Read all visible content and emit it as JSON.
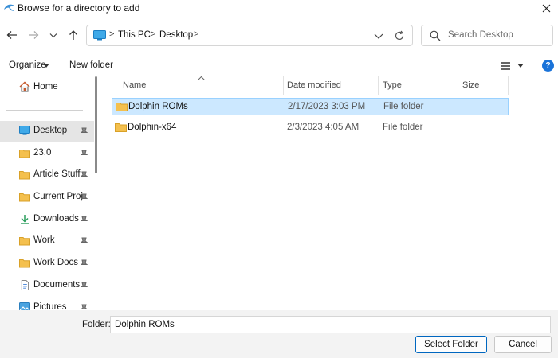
{
  "window": {
    "title": "Browse for a directory to add"
  },
  "address": {
    "crumbs": [
      "This PC",
      "Desktop"
    ],
    "separator": ">"
  },
  "search": {
    "placeholder": "Search Desktop"
  },
  "toolbar": {
    "organize_label": "Organize",
    "new_folder_label": "New folder",
    "help_label": "?"
  },
  "sidebar": {
    "home_label": "Home",
    "items": [
      {
        "label": "Desktop",
        "icon": "desktop-icon",
        "pinned": true,
        "selected": true
      },
      {
        "label": "23.0",
        "icon": "folder-icon",
        "pinned": true
      },
      {
        "label": "Article Stuff",
        "icon": "folder-icon",
        "pinned": true
      },
      {
        "label": "Current Proje",
        "icon": "folder-icon",
        "pinned": true
      },
      {
        "label": "Downloads",
        "icon": "download-icon",
        "pinned": true
      },
      {
        "label": "Work",
        "icon": "folder-icon",
        "pinned": true
      },
      {
        "label": "Work Docs",
        "icon": "folder-icon",
        "pinned": true
      },
      {
        "label": "Documents",
        "icon": "documents-icon",
        "pinned": true
      },
      {
        "label": "Pictures",
        "icon": "pictures-icon",
        "pinned": true
      }
    ]
  },
  "list": {
    "columns": [
      "Name",
      "Date modified",
      "Type",
      "Size"
    ],
    "rows": [
      {
        "name": "Dolphin ROMs",
        "date": "2/17/2023 3:03 PM",
        "type": "File folder",
        "selected": true
      },
      {
        "name": "Dolphin-x64",
        "date": "2/3/2023 4:05 AM",
        "type": "File folder",
        "selected": false
      }
    ]
  },
  "footer": {
    "folder_label": "Folder:",
    "folder_value": "Dolphin ROMs",
    "select_label": "Select Folder",
    "cancel_label": "Cancel"
  },
  "colors": {
    "accent": "#0067c0",
    "selection_bg": "#cce8ff",
    "folder": "#f4c04e"
  }
}
